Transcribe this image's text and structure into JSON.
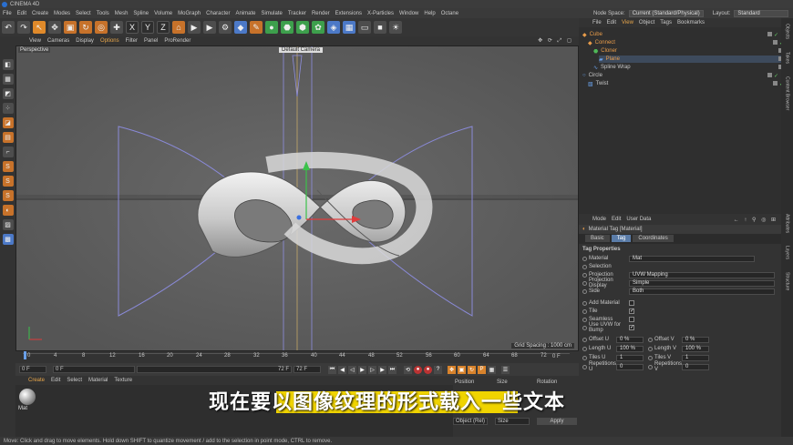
{
  "app": {
    "title": "CINEMA 4D"
  },
  "menubar": {
    "items": [
      "File",
      "Edit",
      "Create",
      "Modes",
      "Select",
      "Tools",
      "Mesh",
      "Spline",
      "Volume",
      "MoGraph",
      "Character",
      "Animate",
      "Simulate",
      "Tracker",
      "Render",
      "Extensions",
      "X-Particles",
      "Window",
      "Help",
      "Octane"
    ]
  },
  "topright": {
    "node_space_label": "Node Space:",
    "node_space_value": "Current (Standard/Physical)",
    "layout_label": "Layout:",
    "layout_value": "Standard"
  },
  "viewport": {
    "menu": [
      "View",
      "Cameras",
      "Display",
      "Options",
      "Filter",
      "Panel",
      "ProRender"
    ],
    "label": "Perspective",
    "camera": "Default Camera",
    "grid_spacing": "Grid Spacing : 1000 cm"
  },
  "timeline": {
    "ticks": [
      "0",
      "4",
      "8",
      "12",
      "16",
      "20",
      "24",
      "28",
      "32",
      "36",
      "40",
      "44",
      "48",
      "52",
      "56",
      "60",
      "64",
      "68",
      "72"
    ],
    "end_marker": "0 F"
  },
  "transport": {
    "current_frame": "0 F",
    "start_frame": "0 F",
    "end_frame": "72 F",
    "max_frame": "72 F"
  },
  "material_manager": {
    "menu": [
      "Create",
      "Edit",
      "Select",
      "Material",
      "Texture"
    ],
    "material_name": "Mat"
  },
  "coordinates": {
    "headers": [
      "Position",
      "Size",
      "Rotation"
    ],
    "mode_select": "Object (Rel)",
    "size_select": "Size",
    "apply_label": "Apply"
  },
  "object_manager": {
    "menu": [
      "File",
      "Edit",
      "View",
      "Object",
      "Tags",
      "Bookmarks"
    ],
    "objects": [
      {
        "name": "Cube",
        "color": "#e89c4a"
      },
      {
        "name": "Connect",
        "color": "#e89c4a"
      },
      {
        "name": "Cloner",
        "color": "#e89c4a"
      },
      {
        "name": "Plane",
        "color": "#e89c4a"
      },
      {
        "name": "Spline Wrap",
        "color": "#c8c8c8"
      },
      {
        "name": "Circle",
        "color": "#c8c8c8"
      },
      {
        "name": "Twist",
        "color": "#c8c8c8"
      }
    ]
  },
  "attributes": {
    "menu": [
      "Mode",
      "Edit",
      "User Data"
    ],
    "header": "Material Tag [Material]",
    "tabs": [
      "Basic",
      "Tag",
      "Coordinates"
    ],
    "section": "Tag Properties",
    "rows": {
      "material_label": "Material",
      "material_value": "Mat",
      "selection_label": "Selection",
      "projection_label": "Projection",
      "projection_value": "UVW Mapping",
      "projection_display_label": "Projection Display",
      "projection_display_value": "Simple",
      "side_label": "Side",
      "side_value": "Both",
      "add_material_label": "Add Material",
      "tile_label": "Tile",
      "seamless_label": "Seamless",
      "use_uvw_label": "Use UVW for Bump",
      "offset_u_label": "Offset U",
      "offset_u_value": "0 %",
      "offset_v_label": "Offset V",
      "offset_v_value": "0 %",
      "length_u_label": "Length U",
      "length_u_value": "100 %",
      "length_v_label": "Length V",
      "length_v_value": "100 %",
      "tiles_u_label": "Tiles U",
      "tiles_u_value": "1",
      "tiles_v_label": "Tiles V",
      "tiles_v_value": "1",
      "rep_u_label": "Repetitions U",
      "rep_u_value": "0",
      "rep_v_label": "Repetitions V",
      "rep_v_value": "0"
    }
  },
  "right_tabs": [
    "Objects",
    "Takes",
    "Content Browser",
    "Attributes",
    "Layers",
    "Structure"
  ],
  "status_text": "Move: Click and drag to move elements. Hold down SHIFT to quantize movement / add to the selection in point mode, CTRL to remove.",
  "subtitle": "现在要以图像纹理的形式载入一些文本",
  "colors": {
    "accent": "#e6a54a",
    "highlight": "#f0d400",
    "viewport_bg": "#5b5b5b"
  }
}
